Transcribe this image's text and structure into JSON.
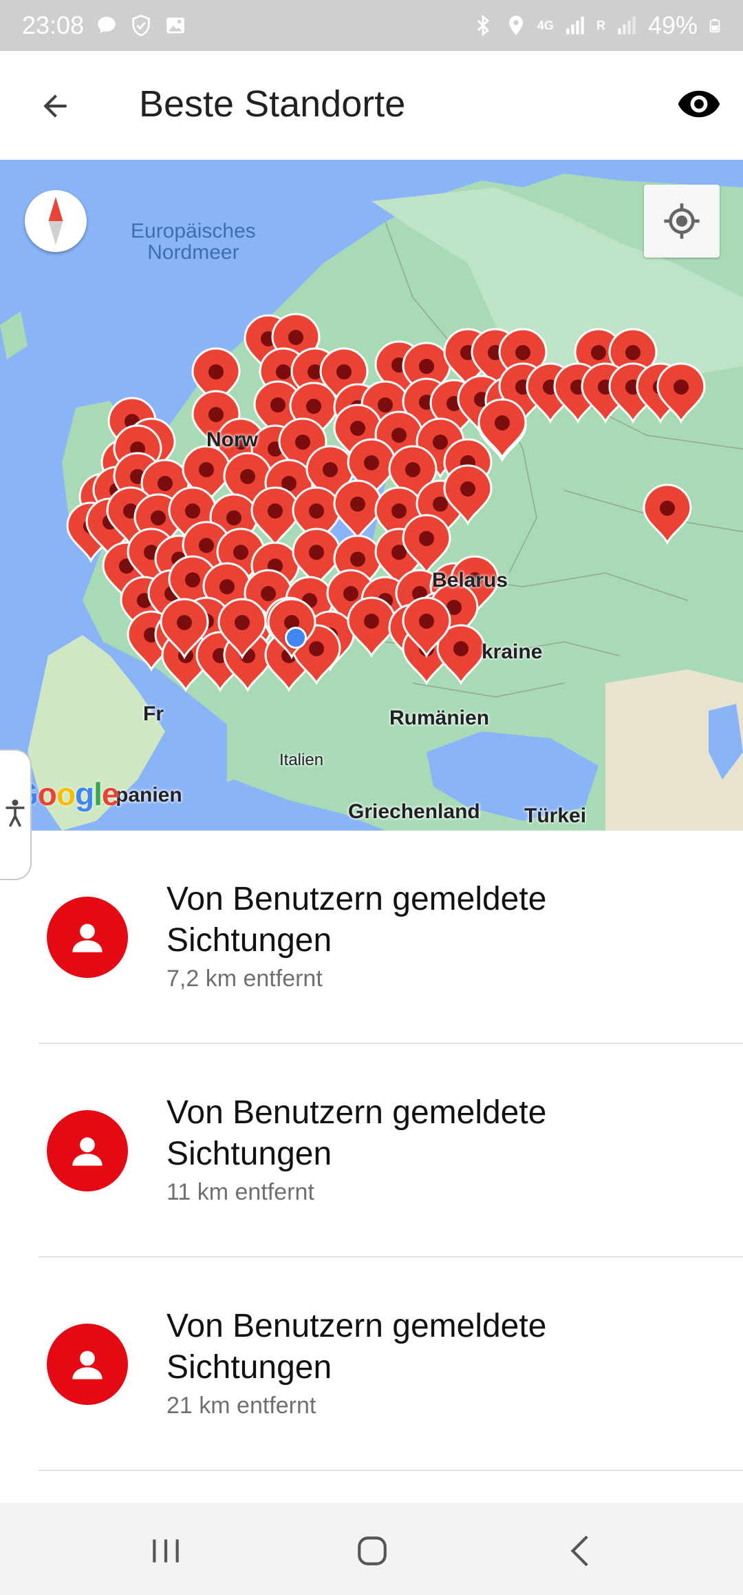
{
  "status_bar": {
    "time": "23:08",
    "battery": "49%",
    "network_label": "4G",
    "roaming_label": "R",
    "left_icons": [
      "chat-bubble-icon",
      "shield-check-icon",
      "image-icon"
    ],
    "right_icons": [
      "bluetooth-icon",
      "location-icon",
      "signal-icon",
      "signal-roaming-icon",
      "battery-icon"
    ]
  },
  "app_bar": {
    "title": "Beste Standorte",
    "back_icon": "arrow-left-icon",
    "action_icon": "eye-icon"
  },
  "map": {
    "sea_label": "Europäisches\nNordmeer",
    "labels": {
      "norway": "Norw",
      "belarus": "Belarus",
      "ukraine": "kraine",
      "romania": "Rumänien",
      "italy": "Italien",
      "spain": "panien",
      "greece": "Griechenland",
      "turkey": "Türkei",
      "france": "Fr"
    },
    "google_logo": [
      "G",
      "o",
      "o",
      "g",
      "l",
      "e"
    ],
    "google_colors": [
      "#4285f4",
      "#ea4335",
      "#fbbc05",
      "#4285f4",
      "#34a853",
      "#ea4335"
    ],
    "pin_color": "#ea4335",
    "water_color": "#8ab4f8",
    "land_color": "#a8dab5"
  },
  "list": {
    "items": [
      {
        "title": "Von Benutzern gemeldete Sichtungen",
        "distance": "7,2 km entfernt",
        "icon": "person-icon"
      },
      {
        "title": "Von Benutzern gemeldete Sichtungen",
        "distance": "11 km entfernt",
        "icon": "person-icon"
      },
      {
        "title": "Von Benutzern gemeldete Sichtungen",
        "distance": "21 km entfernt",
        "icon": "person-icon"
      }
    ]
  },
  "nav_bar": {
    "icons": [
      "recent-apps-icon",
      "home-icon",
      "back-icon"
    ]
  },
  "colors": {
    "accent_red": "#e50914",
    "status_bar_bg": "#cfcfcf",
    "nav_bar_bg": "#f3f3f5"
  }
}
